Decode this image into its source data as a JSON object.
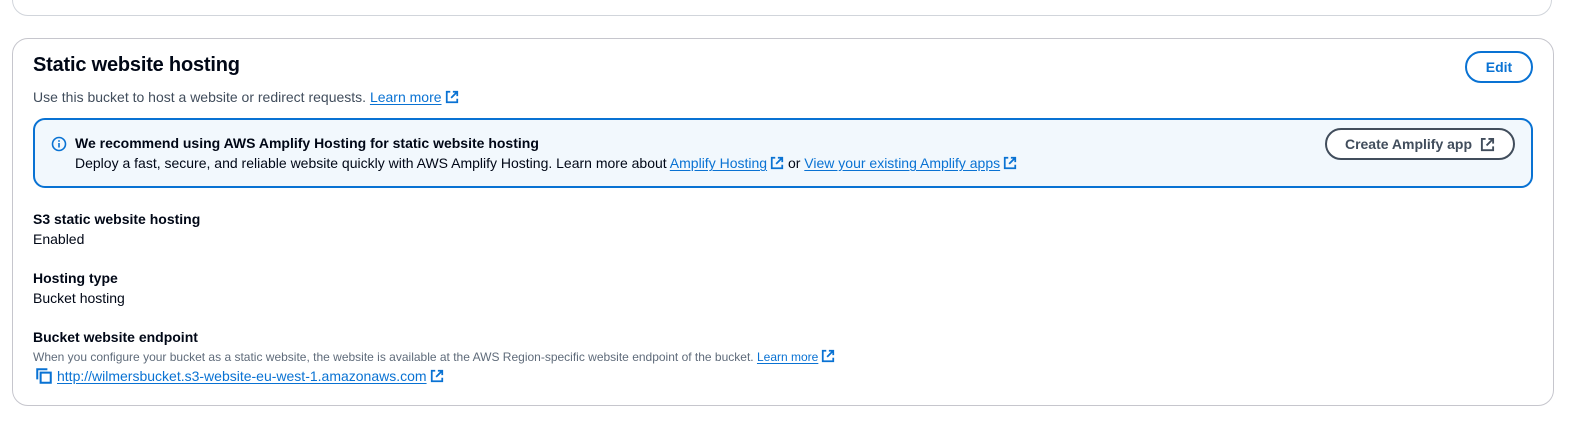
{
  "panel": {
    "title": "Static website hosting",
    "description": "Use this bucket to host a website or redirect requests.",
    "learn_more": "Learn more",
    "edit_label": "Edit"
  },
  "alert": {
    "title": "We recommend using AWS Amplify Hosting for static website hosting",
    "body_prefix": "Deploy a fast, secure, and reliable website quickly with AWS Amplify Hosting. Learn more about",
    "link_amplify_hosting": "Amplify Hosting",
    "or_text": "or",
    "link_view_apps": "View your existing Amplify apps",
    "button_label": "Create Amplify app"
  },
  "fields": {
    "s3_hosting": {
      "label": "S3 static website hosting",
      "value": "Enabled"
    },
    "hosting_type": {
      "label": "Hosting type",
      "value": "Bucket hosting"
    },
    "endpoint": {
      "label": "Bucket website endpoint",
      "description": "When you configure your bucket as a static website, the website is available at the AWS Region-specific website endpoint of the bucket.",
      "learn_more": "Learn more",
      "url": "http://wilmersbucket.s3-website-eu-west-1.amazonaws.com"
    }
  },
  "icons": {
    "info": "info-icon",
    "external": "external-link-icon",
    "copy": "copy-icon"
  },
  "colors": {
    "link": "#0972d3",
    "alert_bg": "#f2f8fd",
    "alert_border": "#0972d3",
    "text": "#000716"
  }
}
